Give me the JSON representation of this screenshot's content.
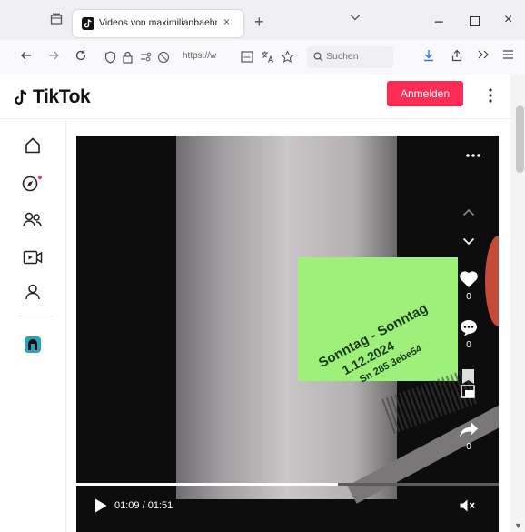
{
  "browser": {
    "tab_title": "Videos von maximilianbaehring",
    "tab_close": "×",
    "new_tab": "+",
    "url_text": "https://w",
    "search_placeholder": "Suchen",
    "window_min": "−",
    "window_close": "×"
  },
  "tiktok": {
    "logo_text": "TikTok",
    "login_label": "Anmelden",
    "accent_color": "#fe2c55",
    "sidebar_icons": [
      "home-icon",
      "explore-icon",
      "following-icon",
      "live-icon",
      "profile-icon",
      "creator-avatar"
    ]
  },
  "video": {
    "label_lines": [
      "Sonntag - Sonntag",
      "1.12.2024",
      "Sn 285 3ebe54"
    ],
    "like_count": "0",
    "comment_count": "0",
    "share_count": "0",
    "time_display": "01:09 / 01:51",
    "progress_fraction": 0.62
  }
}
